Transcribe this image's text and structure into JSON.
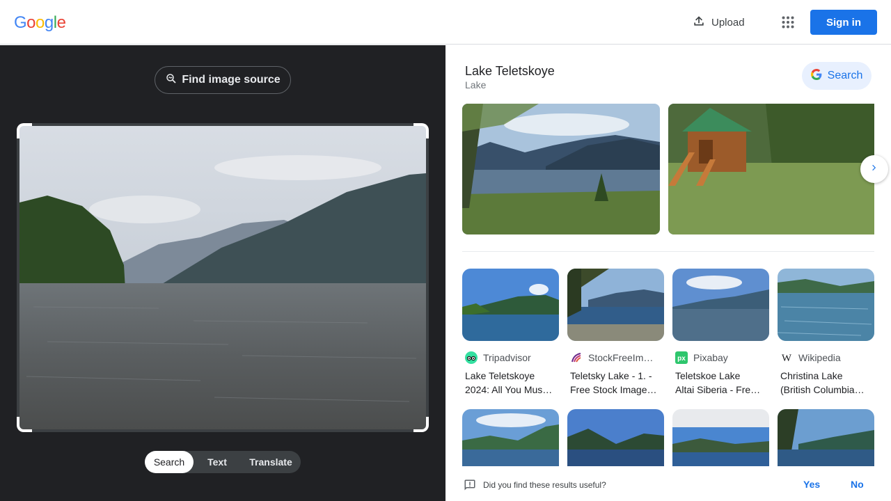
{
  "header": {
    "logo": [
      "G",
      "o",
      "o",
      "g",
      "l",
      "e"
    ],
    "logo_colors": [
      "#4285f4",
      "#ea4335",
      "#fbbc05",
      "#4285f4",
      "#34a853",
      "#ea4335"
    ],
    "upload_label": "Upload",
    "apps_icon": "apps-grid-icon",
    "signin_label": "Sign in"
  },
  "left": {
    "find_source_label": "Find image source",
    "tabs": [
      {
        "label": "Search",
        "active": true
      },
      {
        "label": "Text",
        "active": false
      },
      {
        "label": "Translate",
        "active": false
      }
    ]
  },
  "right": {
    "entity_title": "Lake Teletskoye",
    "entity_subtitle": "Lake",
    "search_chip_label": "Search",
    "results": [
      {
        "source": "Tripadvisor",
        "title_line1": "Lake Teletskoye",
        "title_line2": "2024: All You Mus…"
      },
      {
        "source": "StockFreeIma…",
        "title_line1": "Teletsky Lake - 1. -",
        "title_line2": "Free Stock Image…"
      },
      {
        "source": "Pixabay",
        "title_line1": "Teletskoe Lake",
        "title_line2": "Altai Siberia - Fre…"
      },
      {
        "source": "Wikipedia",
        "title_line1": "Christina Lake",
        "title_line2": "(British Columbia…"
      }
    ],
    "feedback": {
      "question": "Did you find these results useful?",
      "yes": "Yes",
      "no": "No"
    }
  },
  "colors": {
    "accent": "#1a73e8",
    "dark_panel": "#202124"
  }
}
